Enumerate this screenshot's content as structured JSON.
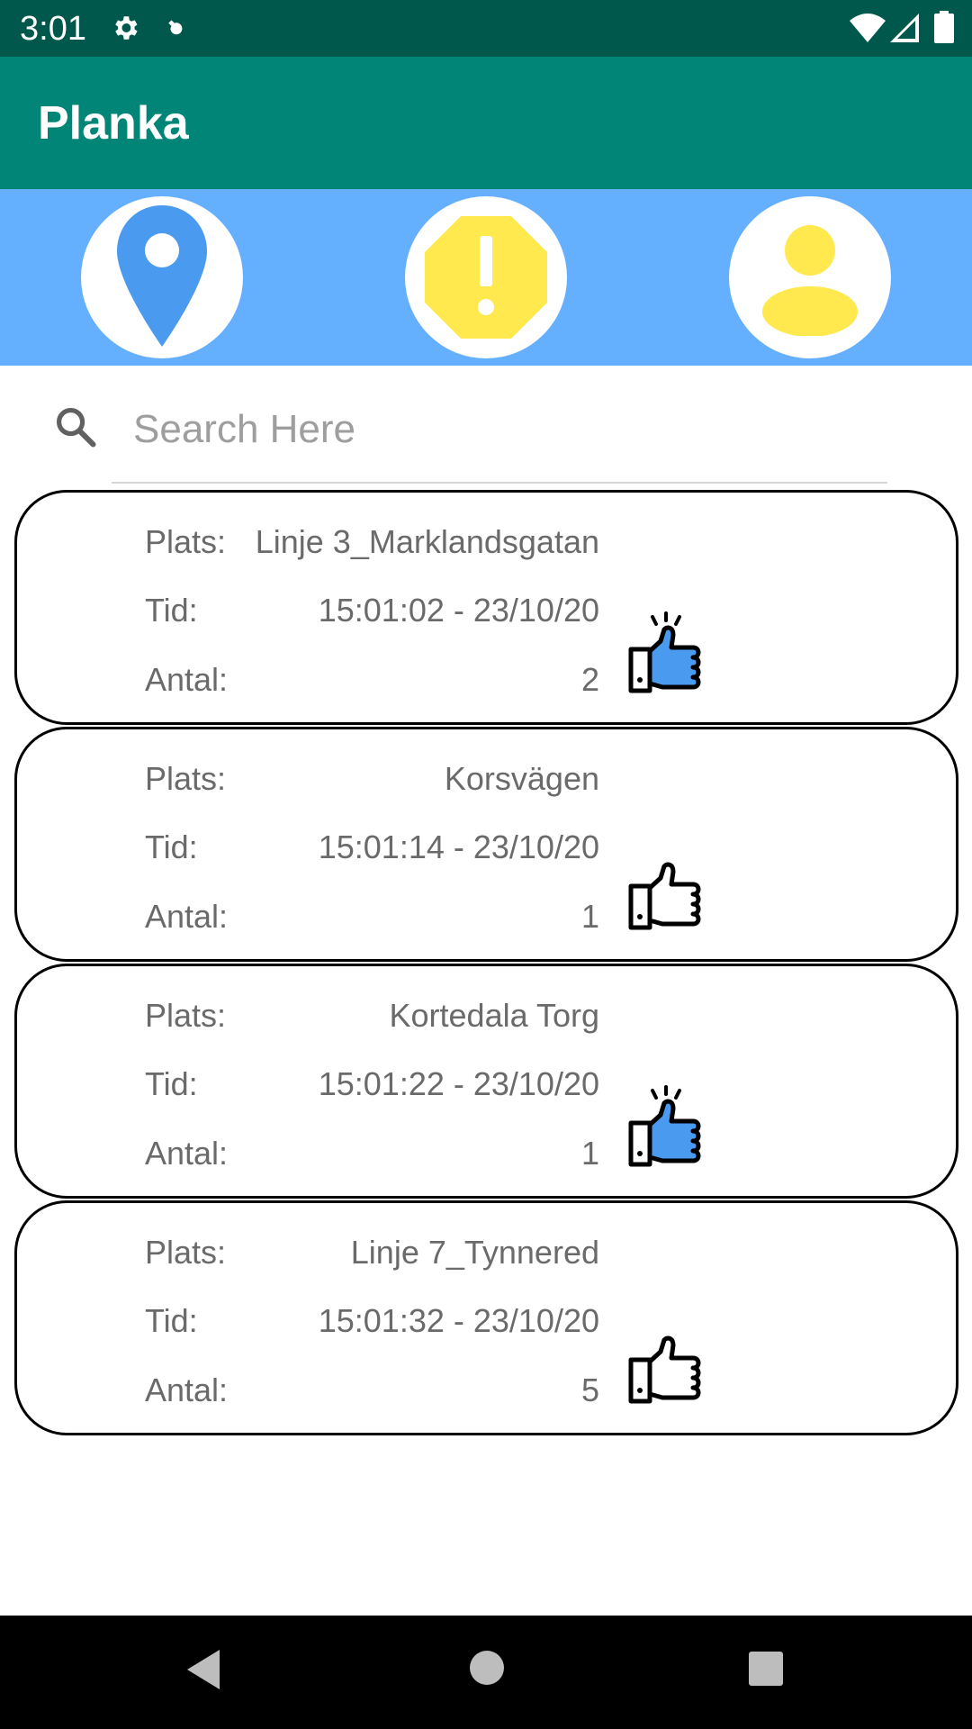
{
  "status_bar": {
    "time": "3:01",
    "icons": [
      "gear-icon",
      "debug-icon",
      "wifi-icon",
      "signal-icon",
      "battery-icon"
    ]
  },
  "app_bar": {
    "title": "Planka"
  },
  "nav": {
    "items": [
      {
        "icon": "location-pin-icon"
      },
      {
        "icon": "warning-octagon-icon"
      },
      {
        "icon": "profile-icon"
      }
    ]
  },
  "search": {
    "placeholder": "Search Here",
    "value": ""
  },
  "cards": [
    {
      "plats_label": "Plats:",
      "plats": "Linje 3_Marklandsgatan",
      "tid_label": "Tid:",
      "tid": "15:01:02 - 23/10/20",
      "antal_label": "Antal:",
      "antal": "2",
      "liked": true
    },
    {
      "plats_label": "Plats:",
      "plats": "Korsvägen",
      "tid_label": "Tid:",
      "tid": "15:01:14 - 23/10/20",
      "antal_label": "Antal:",
      "antal": "1",
      "liked": false
    },
    {
      "plats_label": "Plats:",
      "plats": "Kortedala Torg",
      "tid_label": "Tid:",
      "tid": "15:01:22 - 23/10/20",
      "antal_label": "Antal:",
      "antal": "1",
      "liked": true
    },
    {
      "plats_label": "Plats:",
      "plats": "Linje 7_Tynnered",
      "tid_label": "Tid:",
      "tid": "15:01:32 - 23/10/20",
      "antal_label": "Antal:",
      "antal": "5",
      "liked": false
    }
  ],
  "system_nav": {
    "icons": [
      "back-icon",
      "home-icon",
      "recents-icon"
    ]
  },
  "colors": {
    "status_bar": "#00574B",
    "app_bar": "#008577",
    "nav_strip": "#64B0FF",
    "accent_yellow": "#FFE94F",
    "liked_blue": "#4A9BF0"
  }
}
